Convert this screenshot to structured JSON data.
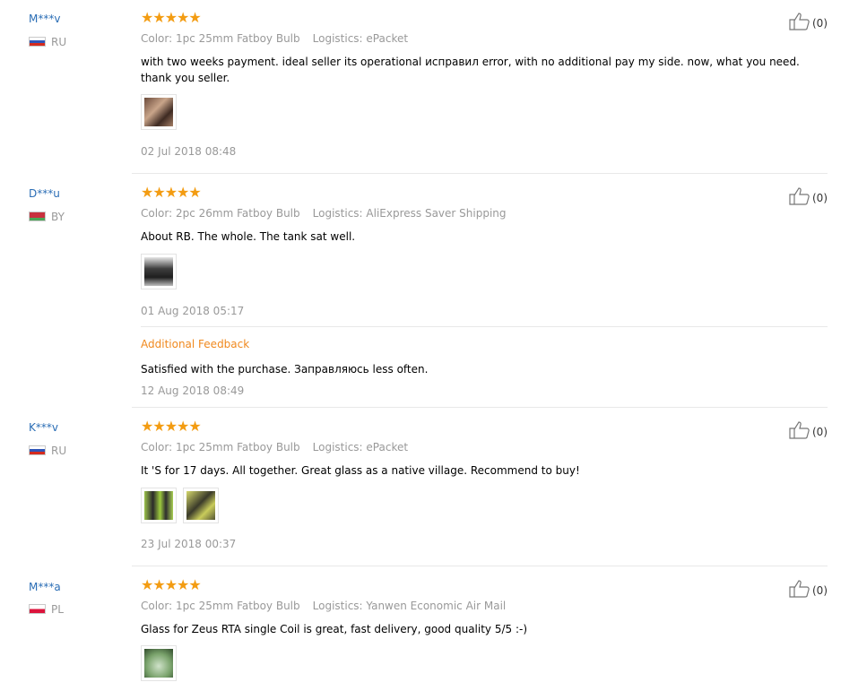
{
  "reviews": [
    {
      "user": "M***v",
      "country": "RU",
      "stars": "★★★★★",
      "color": "Color: 1pc 25mm Fatboy Bulb",
      "logistics": "Logistics: ePacket",
      "text": "with two weeks payment. ideal seller its operational исправил error, with no additional pay my side. now, what you need. thank you seller.",
      "date": "02 Jul 2018 08:48",
      "likes": "(0)"
    },
    {
      "user": "D***u",
      "country": "BY",
      "stars": "★★★★★",
      "color": "Color: 2pc 26mm Fatboy Bulb",
      "logistics": "Logistics: AliExpress Saver Shipping",
      "text": "About RB. The whole. The tank sat well.",
      "date": "01 Aug 2018 05:17",
      "additional_label": "Additional Feedback",
      "additional_text": "Satisfied with the purchase. Заправляюсь less often.",
      "additional_date": "12 Aug 2018 08:49",
      "likes": "(0)"
    },
    {
      "user": "K***v",
      "country": "RU",
      "stars": "★★★★★",
      "color": "Color: 1pc 25mm Fatboy Bulb",
      "logistics": "Logistics: ePacket",
      "text": "It 'S for 17 days. All together. Great glass as a native village. Recommend to buy!",
      "date": "23 Jul 2018 00:37",
      "likes": "(0)"
    },
    {
      "user": "M***a",
      "country": "PL",
      "stars": "★★★★★",
      "color": "Color: 1pc 25mm Fatboy Bulb",
      "logistics": "Logistics: Yanwen Economic Air Mail",
      "text": "Glass for Zeus RTA single Coil is great, fast delivery, good quality 5/5 :-)",
      "likes": "(0)"
    }
  ],
  "colors": {
    "star": "#f39c12",
    "username": "#2a6db5",
    "additional_feedback": "#f0891e",
    "meta_gray": "#999999"
  }
}
